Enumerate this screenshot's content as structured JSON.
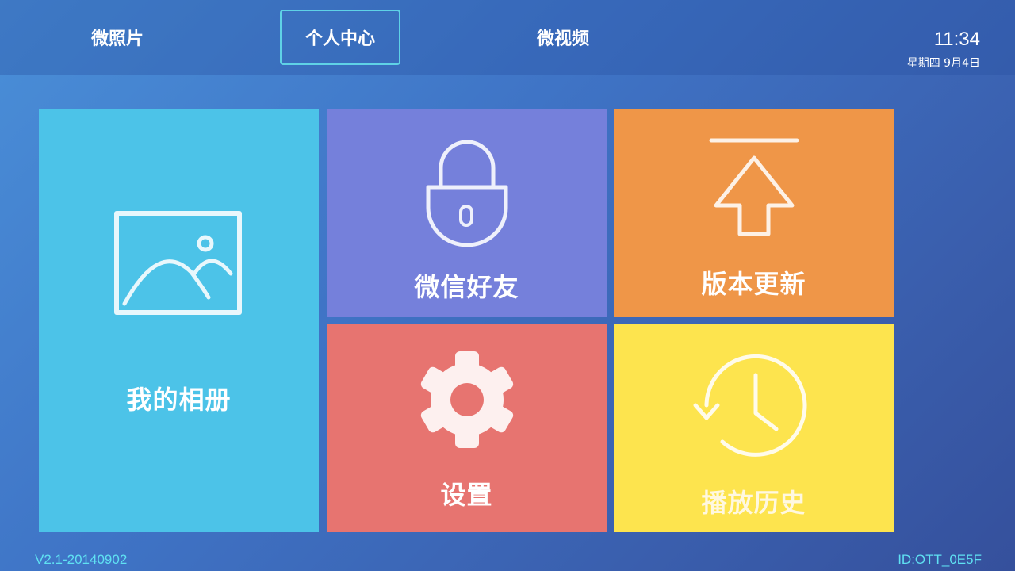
{
  "nav": {
    "tabs": [
      {
        "label": "微照片",
        "active": false
      },
      {
        "label": "个人中心",
        "active": true
      },
      {
        "label": "微视频",
        "active": false
      }
    ]
  },
  "status": {
    "time": "11:34",
    "date": "星期四  9月4日"
  },
  "tiles": {
    "album": {
      "label": "我的相册",
      "icon": "image-icon",
      "color": "#4cc3e8"
    },
    "wechat_friends": {
      "label": "微信好友",
      "icon": "lock-icon",
      "color": "#7580db"
    },
    "update": {
      "label": "版本更新",
      "icon": "upload-icon",
      "color": "#ef9648"
    },
    "settings": {
      "label": "设置",
      "icon": "gear-icon",
      "color": "#e77470"
    },
    "history": {
      "label": "播放历史",
      "icon": "history-clock-icon",
      "color": "#fde44e"
    }
  },
  "footer": {
    "version": "V2.1-20140902",
    "device_id": "ID:OTT_0E5F"
  },
  "colors": {
    "accent": "#5fd2e6",
    "footer_text": "#5fe1f2"
  }
}
